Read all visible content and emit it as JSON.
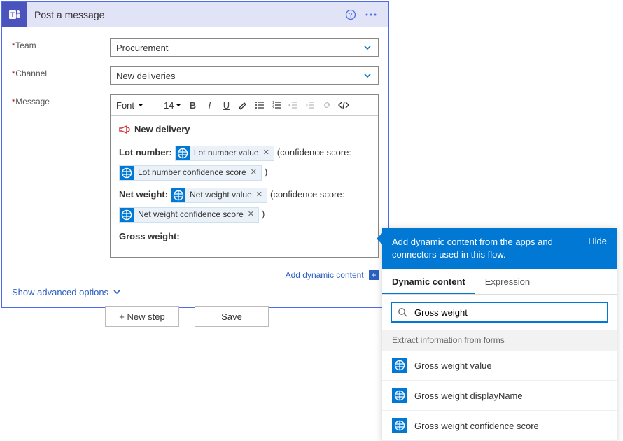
{
  "card": {
    "title": "Post a message",
    "fields": {
      "team": {
        "label": "Team",
        "value": "Procurement"
      },
      "channel": {
        "label": "Channel",
        "value": "New deliveries"
      },
      "message": {
        "label": "Message"
      }
    },
    "editor": {
      "font_label": "Font",
      "size_label": "14",
      "title": "New delivery",
      "line_lot_label": "Lot number:",
      "conf_open": "(confidence score:",
      "conf_close": ")",
      "line_net_label": "Net weight:",
      "line_gross_label": "Gross weight:",
      "tokens": {
        "lot_val": "Lot number value",
        "lot_conf": "Lot number confidence score",
        "net_val": "Net weight value",
        "net_conf": "Net weight confidence score"
      }
    },
    "add_dc_label": "Add dynamic content",
    "advanced_label": "Show advanced options"
  },
  "footer": {
    "new_step": "+ New step",
    "save": "Save"
  },
  "dc": {
    "header_text": "Add dynamic content from the apps and connectors used in this flow.",
    "hide": "Hide",
    "tab_dc": "Dynamic content",
    "tab_expr": "Expression",
    "search_value": "Gross weight",
    "group_header": "Extract information from forms",
    "items": [
      "Gross weight value",
      "Gross weight displayName",
      "Gross weight confidence score"
    ]
  }
}
